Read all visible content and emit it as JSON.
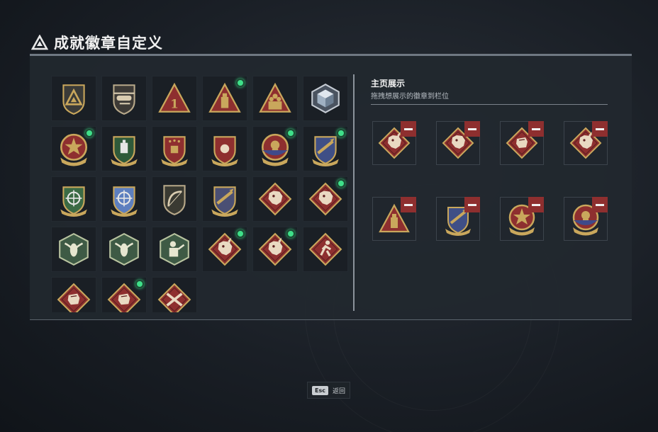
{
  "page": {
    "title": "成就徽章自定义",
    "title_icon": "warning-triangle-icon"
  },
  "badges": [
    {
      "name": "triangle-shield-badge",
      "new": false
    },
    {
      "name": "helicopter-shield-badge",
      "new": false
    },
    {
      "name": "number-one-triangle-badge",
      "new": false
    },
    {
      "name": "ammo-triangle-badge",
      "new": true
    },
    {
      "name": "soldiers-triangle-badge",
      "new": false
    },
    {
      "name": "crystal-cube-badge",
      "new": false
    },
    {
      "name": "red-star-medal-badge",
      "new": true
    },
    {
      "name": "green-shield-medal-badge",
      "new": false
    },
    {
      "name": "red-shield-stars-medal-badge",
      "new": false
    },
    {
      "name": "red-shield-fist-medal-badge",
      "new": false
    },
    {
      "name": "skull-roundel-medal-badge",
      "new": true
    },
    {
      "name": "missile-shield-medal-badge",
      "new": true
    },
    {
      "name": "green-crosshair-shield-badge",
      "new": false
    },
    {
      "name": "blue-crosshair-shield-badge",
      "new": false
    },
    {
      "name": "bow-shield-badge",
      "new": false
    },
    {
      "name": "gold-missile-shield-badge",
      "new": false
    },
    {
      "name": "wolf-diamond-badge",
      "new": false
    },
    {
      "name": "wolf-diamond-badge-2",
      "new": true
    },
    {
      "name": "hornet-hexagon-badge",
      "new": false
    },
    {
      "name": "hornet-hexagon-badge-2",
      "new": false
    },
    {
      "name": "soldier-hexagon-badge",
      "new": false
    },
    {
      "name": "dragon-diamond-badge",
      "new": true
    },
    {
      "name": "dragon-diamond-badge-2",
      "new": true
    },
    {
      "name": "runner-diamond-badge",
      "new": false
    },
    {
      "name": "fist-diamond-badge",
      "new": false
    },
    {
      "name": "fist-diamond-badge-2",
      "new": true
    },
    {
      "name": "crossed-rifles-diamond-badge",
      "new": false
    }
  ],
  "showcase": {
    "title": "主页展示",
    "subtitle": "拖拽想展示的徽章到栏位",
    "slots": [
      {
        "name": "dragon-diamond-badge",
        "remove_icon": "minus-icon"
      },
      {
        "name": "wolf-diamond-badge",
        "remove_icon": "minus-icon"
      },
      {
        "name": "fist-diamond-badge",
        "remove_icon": "minus-icon"
      },
      {
        "name": "dragon-diamond-badge",
        "remove_icon": "minus-icon"
      },
      {
        "name": "ammo-triangle-badge",
        "remove_icon": "minus-icon"
      },
      {
        "name": "missile-shield-medal-badge",
        "remove_icon": "minus-icon"
      },
      {
        "name": "red-star-medal-badge",
        "remove_icon": "minus-icon"
      },
      {
        "name": "skull-roundel-medal-badge",
        "remove_icon": "minus-icon"
      }
    ]
  },
  "footer": {
    "key": "Esc",
    "label": "返回"
  },
  "colors": {
    "gold": "#c9a75c",
    "dark_gold": "#8a6d35",
    "crimson": "#8e2f2f",
    "green_dot": "#3fe08a",
    "steel_blue": "#5d7fbf",
    "olive_green": "#3b6b45"
  }
}
